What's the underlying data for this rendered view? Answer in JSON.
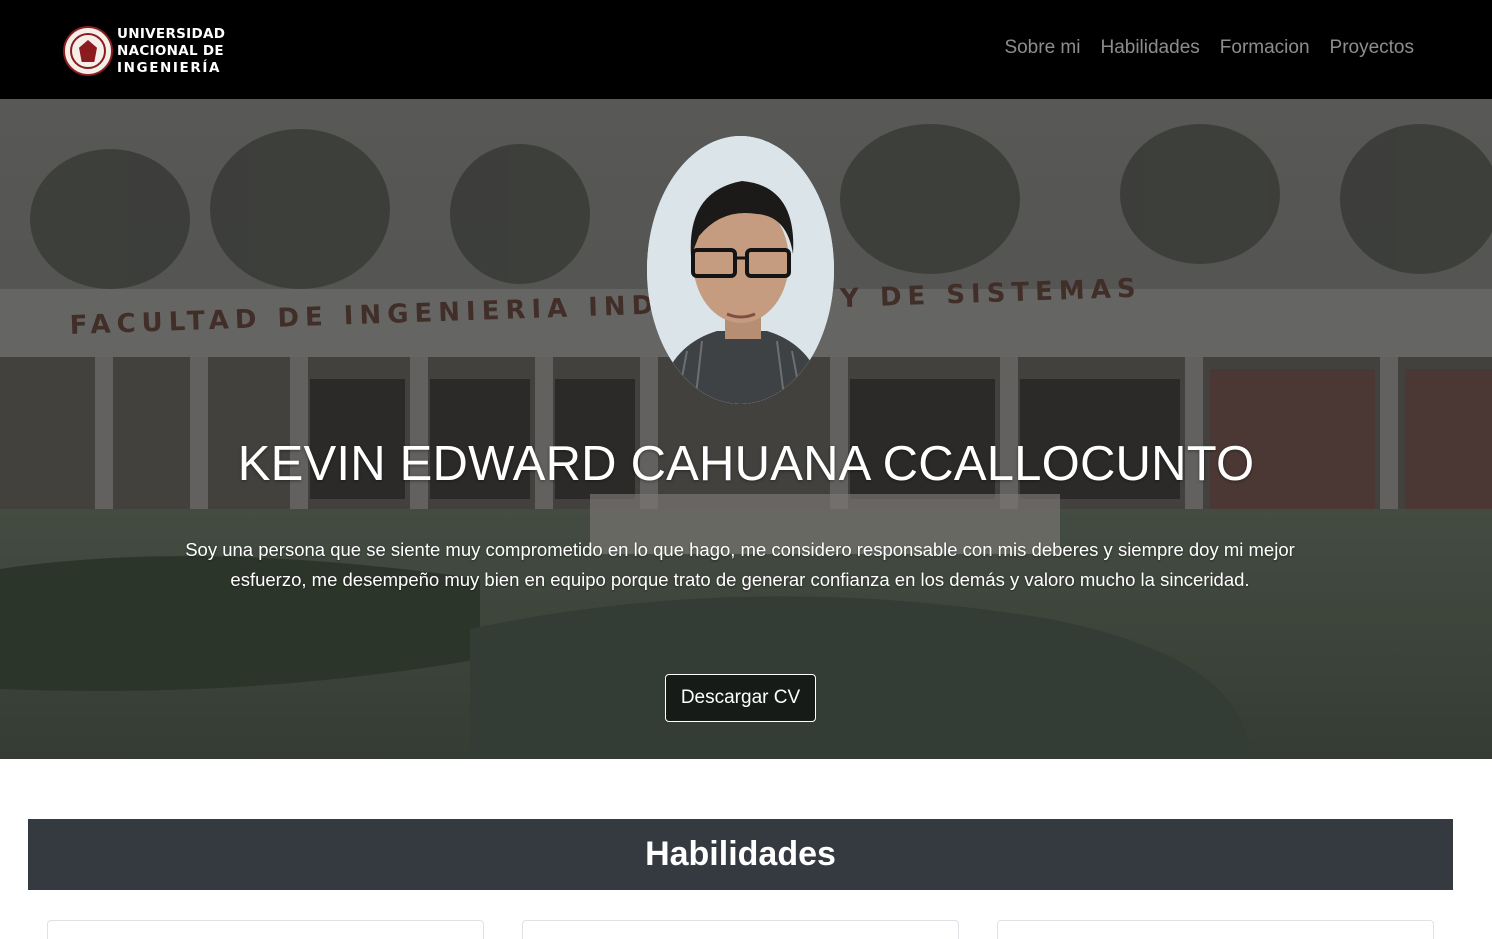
{
  "brand": {
    "line1": "UNIVERSIDAD",
    "line2": "NACIONAL DE",
    "line3": "INGENIERÍA",
    "logo_icon": "university-seal-icon"
  },
  "nav": {
    "items": [
      {
        "label": "Sobre mi"
      },
      {
        "label": "Habilidades"
      },
      {
        "label": "Formacion"
      },
      {
        "label": "Proyectos"
      }
    ]
  },
  "hero": {
    "name": "KEVIN EDWARD CAHUANA CCALLOCUNTO",
    "description": "Soy una persona que se siente muy comprometido en lo que hago, me considero responsable con mis deberes y siempre doy mi mejor esfuerzo, me desempeño muy bien en equipo porque trato de generar confianza en los demás y valoro mucho la sinceridad.",
    "cv_button": "Descargar CV",
    "building_sign": "FACULTAD DE INGENIERIA INDUSTRIAL Y DE SISTEMAS"
  },
  "skills": {
    "title": "Habilidades"
  },
  "colors": {
    "navbar_bg": "#000000",
    "nav_link": "rgba(255,255,255,0.55)",
    "section_header_bg": "#343a40",
    "seal_red": "#8b1b1e"
  }
}
